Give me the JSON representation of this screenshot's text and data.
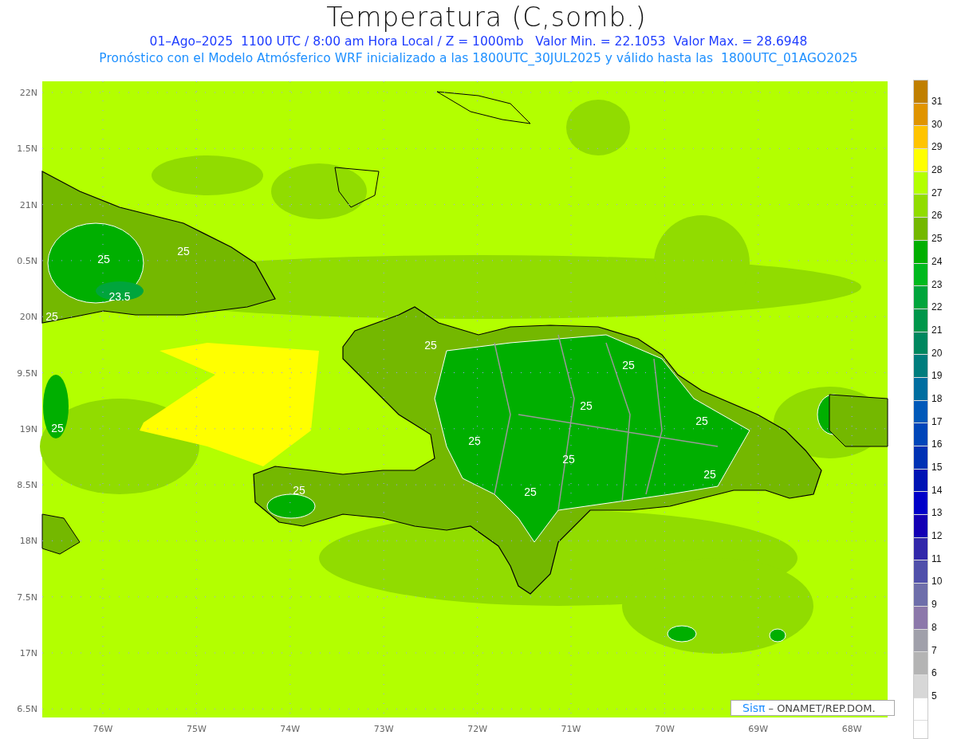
{
  "title": "Temperatura (C,somb.)",
  "subtitle": "01–Ago–2025  1100 UTC / 8:00 am Hora Local / Z = 1000mb   Valor Min. = 22.1053  Valor Max. = 28.6948",
  "model_line": "Pronóstico con el Modelo Atmósferico WRF inicializado a las 1800UTC_30JUL2025 y válido hasta las  1800UTC_01AGO2025",
  "map": {
    "lat_labels": [
      "22N",
      "1.5N",
      "21N",
      "0.5N",
      "20N",
      "9.5N",
      "19N",
      "8.5N",
      "18N",
      "7.5N",
      "17N",
      "6.5N"
    ],
    "lon_labels": [
      "76W",
      "75W",
      "74W",
      "73W",
      "72W",
      "71W",
      "70W",
      "69W",
      "68W"
    ],
    "contour_labels": [
      "25",
      "25",
      "23.5",
      "25",
      "25",
      "25",
      "25",
      "25",
      "25",
      "25",
      "25",
      "25",
      "25",
      "25"
    ]
  },
  "credit": {
    "brand": "Sisπ",
    "text": "– ONAMET/REP.DOM."
  },
  "colorbar": {
    "labels": [
      "31",
      "30",
      "29",
      "28",
      "27",
      "26",
      "25",
      "24",
      "23",
      "22",
      "21",
      "20",
      "19",
      "18",
      "17",
      "16",
      "15",
      "14",
      "13",
      "12",
      "11",
      "10",
      "9",
      "8",
      "7",
      "6",
      "5"
    ],
    "swatches": [
      {
        "color": "#c07f00"
      },
      {
        "color": "#e09400"
      },
      {
        "color": "#ffc400"
      },
      {
        "color": "#ffff00"
      },
      {
        "color": "#b3ff00"
      },
      {
        "color": "#91dc00"
      },
      {
        "color": "#74b800"
      },
      {
        "color": "#00af00"
      },
      {
        "color": "#00b91e"
      },
      {
        "color": "#00a53c"
      },
      {
        "color": "#00964b"
      },
      {
        "color": "#00875f"
      },
      {
        "color": "#007d7d"
      },
      {
        "color": "#006ea0"
      },
      {
        "color": "#0059b9"
      },
      {
        "color": "#0046b9"
      },
      {
        "color": "#0032b4"
      },
      {
        "color": "#0014b4"
      },
      {
        "color": "#0000c8"
      },
      {
        "color": "#1400b4"
      },
      {
        "color": "#3228aa"
      },
      {
        "color": "#5050aa"
      },
      {
        "color": "#6e6eaa"
      },
      {
        "color": "#8c78aa"
      },
      {
        "color": "#a0a0aa"
      },
      {
        "color": "#b4b4b4"
      },
      {
        "color": "#d7d7d7"
      },
      {
        "color": "#ffffff"
      }
    ]
  }
}
